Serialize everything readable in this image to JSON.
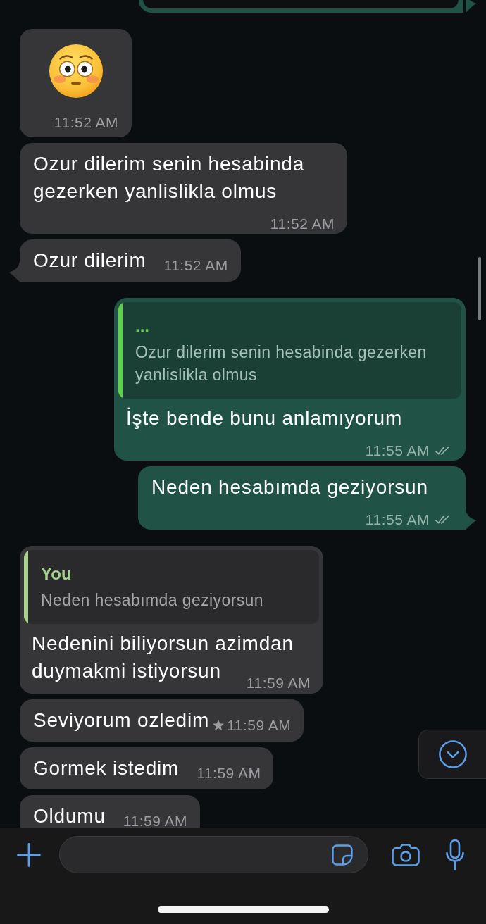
{
  "messages": [
    {
      "outgoing": true,
      "kind": "media",
      "tail": true,
      "starred": false
    },
    {
      "outgoing": false,
      "kind": "emoji",
      "time": "11:52 AM",
      "tail": false,
      "starred": false
    },
    {
      "outgoing": false,
      "kind": "text",
      "text": "Ozur dilerim senin hesabinda gezerken yanlislikla olmus",
      "time": "11:52 AM",
      "tail": false,
      "starred": false
    },
    {
      "outgoing": false,
      "kind": "text",
      "text": "Ozur dilerim",
      "time": "11:52 AM",
      "tail": true,
      "starred": false
    },
    {
      "outgoing": true,
      "kind": "text",
      "quote": {
        "author": "...",
        "text": "Ozur dilerim senin hesabinda gezerken yanlislikla olmus",
        "color": "#5fd04a"
      },
      "text": "İşte bende bunu anlamıyorum",
      "time": "11:55 AM",
      "read": false,
      "tail": false,
      "starred": false
    },
    {
      "outgoing": true,
      "kind": "text",
      "text": "Neden hesabımda geziyorsun",
      "time": "11:55 AM",
      "read": false,
      "tail": true,
      "starred": false
    },
    {
      "outgoing": false,
      "kind": "text",
      "quote": {
        "author": "You",
        "text": "Neden hesabımda geziyorsun",
        "color": "#a6d18f"
      },
      "text": "Nedenini biliyorsun azimdan duymakmi istiyorsun",
      "time": "11:59 AM",
      "tail": false,
      "starred": false
    },
    {
      "outgoing": false,
      "kind": "text",
      "text": "Seviyorum ozledim",
      "time": "11:59 AM",
      "tail": false,
      "starred": true
    },
    {
      "outgoing": false,
      "kind": "text",
      "text": "Gormek istedim",
      "time": "11:59 AM",
      "tail": false,
      "starred": false
    },
    {
      "outgoing": false,
      "kind": "text",
      "text": "Oldumu",
      "time": "11:59 AM",
      "tail": false,
      "starred": false
    }
  ]
}
